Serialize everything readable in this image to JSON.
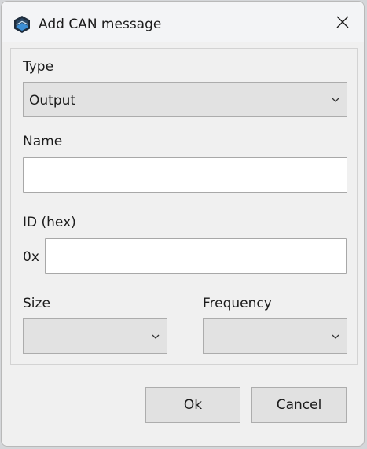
{
  "window": {
    "title": "Add CAN message",
    "close_icon": "close-icon",
    "app_icon": "app-logo-icon"
  },
  "form": {
    "type": {
      "label": "Type",
      "value": "Output"
    },
    "name": {
      "label": "Name",
      "value": ""
    },
    "id": {
      "label": "ID (hex)",
      "prefix": "0x",
      "value": ""
    },
    "size": {
      "label": "Size",
      "value": ""
    },
    "frequency": {
      "label": "Frequency",
      "value": ""
    }
  },
  "buttons": {
    "ok": "Ok",
    "cancel": "Cancel"
  }
}
